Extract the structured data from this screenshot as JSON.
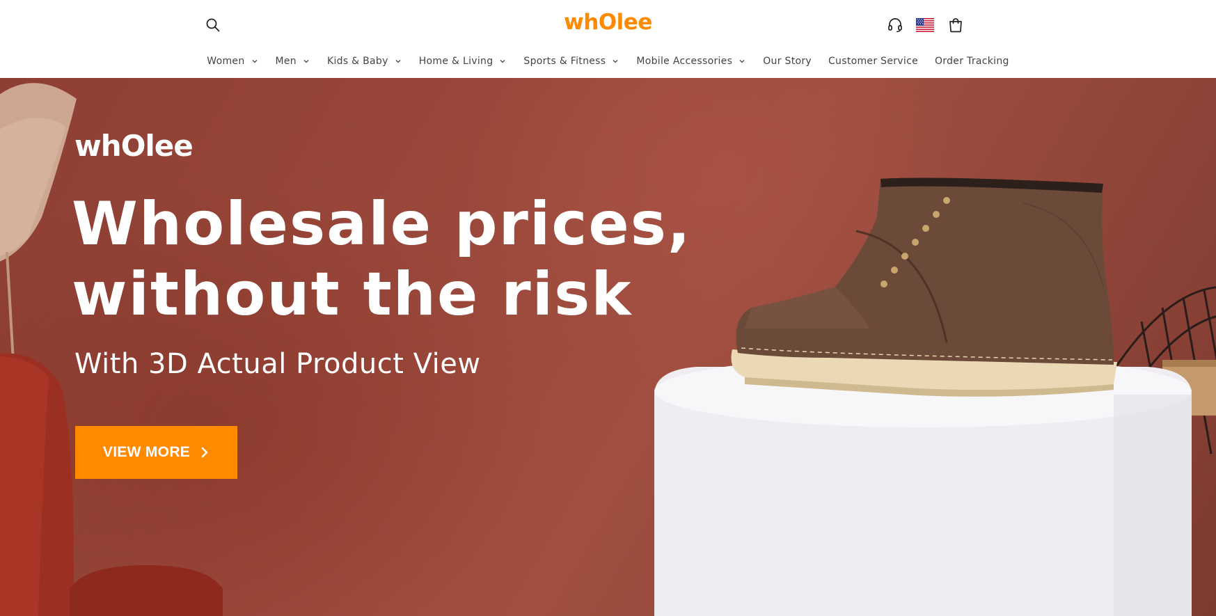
{
  "header": {
    "logo_text": "whOlee",
    "brand_color": "#ff8a00",
    "icons": {
      "search": "search-icon",
      "support": "headset-icon",
      "region": "us-flag-icon",
      "cart": "cart-icon"
    }
  },
  "nav": {
    "items": [
      {
        "label": "Women",
        "has_dropdown": true
      },
      {
        "label": "Men",
        "has_dropdown": true
      },
      {
        "label": "Kids & Baby",
        "has_dropdown": true
      },
      {
        "label": "Home & Living",
        "has_dropdown": true
      },
      {
        "label": "Sports & Fitness",
        "has_dropdown": true
      },
      {
        "label": "Mobile Accessories",
        "has_dropdown": true
      },
      {
        "label": "Our Story",
        "has_dropdown": false
      },
      {
        "label": "Customer Service",
        "has_dropdown": false
      },
      {
        "label": "Order Tracking",
        "has_dropdown": false
      }
    ]
  },
  "hero": {
    "brand": "whOlee",
    "headline_line1": "Wholesale prices,",
    "headline_line2": "without the risk",
    "subheadline": "With 3D Actual Product View",
    "cta_label": "VIEW MORE",
    "cta_color": "#ff8a00"
  }
}
